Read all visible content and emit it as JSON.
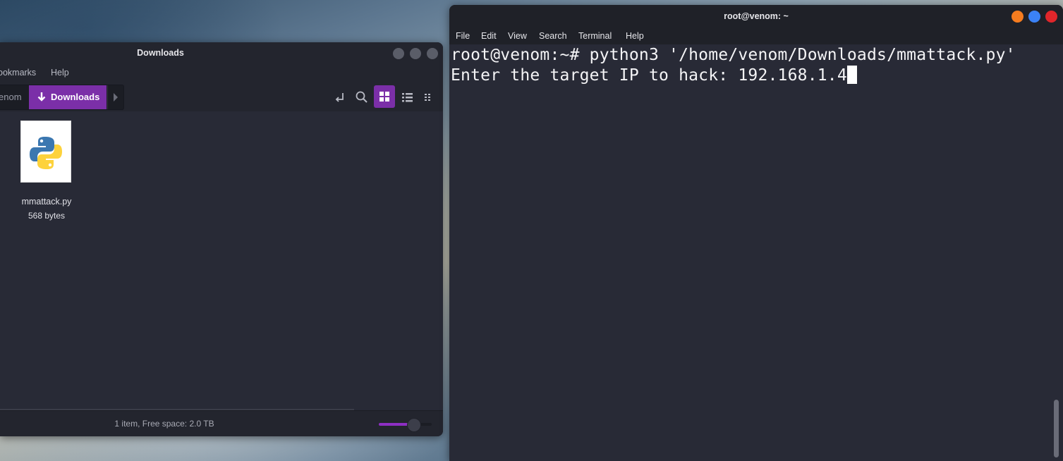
{
  "file_manager": {
    "title": "Downloads",
    "menu": [
      "ookmarks",
      "Help"
    ],
    "breadcrumb": {
      "previous": "enom",
      "current": "Downloads"
    },
    "files": [
      {
        "name": "mmattack.py",
        "size": "568 bytes",
        "icon": "python-file-icon"
      }
    ],
    "status": "1 item, Free space: 2.0 TB",
    "zoom_level": 0.65,
    "accent_color": "#7b2fa8"
  },
  "terminal": {
    "title": "root@venom: ~",
    "menu": [
      "File",
      "Edit",
      "View",
      "Search",
      "Terminal",
      "Help"
    ],
    "lines": [
      "root@venom:~# python3 '/home/venom/Downloads/mmattack.py'",
      "Enter the target IP to hack: 192.168.1.4"
    ],
    "window_button_colors": [
      "#f57c1f",
      "#3b82f6",
      "#e0262b"
    ]
  }
}
